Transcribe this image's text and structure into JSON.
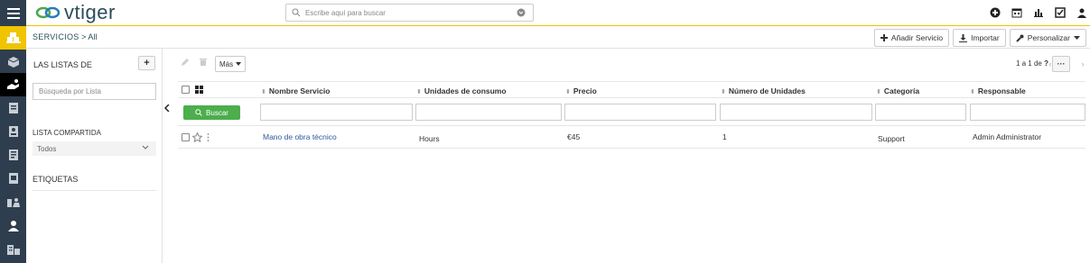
{
  "app": {
    "logo_text": "vtiger",
    "accent": "#f0c400",
    "rail_bg": "#2f3e4e"
  },
  "search": {
    "placeholder": "Escribe aquí para buscar"
  },
  "module": {
    "title": "SERVICIOS",
    "separator": ">",
    "view": "All"
  },
  "actions": {
    "add": "Añadir Servicio",
    "import": "Importar",
    "customize": "Personalizar"
  },
  "sidebar": {
    "lists_title": "LAS LISTAS DE",
    "add_label": "+",
    "list_search_placeholder": "Búsqueda por Lista",
    "shared_title": "LISTA COMPARTIDA",
    "shared_value": "Todos",
    "tags_title": "ETIQUETAS"
  },
  "toolbar": {
    "more": "Más",
    "pagination": "1 a 1",
    "of_label": "de",
    "total": "?",
    "dots": "···"
  },
  "table": {
    "headers": [
      "Nombre Servicio",
      "Unidades de consumo",
      "Precio",
      "Número de Unidades",
      "Categoría",
      "Responsable"
    ],
    "search_button": "Buscar",
    "rows": [
      {
        "name": "Mano de obra técnico",
        "units": "Hours",
        "price": "€45",
        "qty": "1",
        "category": "Support",
        "owner": "Admin Administrator"
      }
    ]
  }
}
